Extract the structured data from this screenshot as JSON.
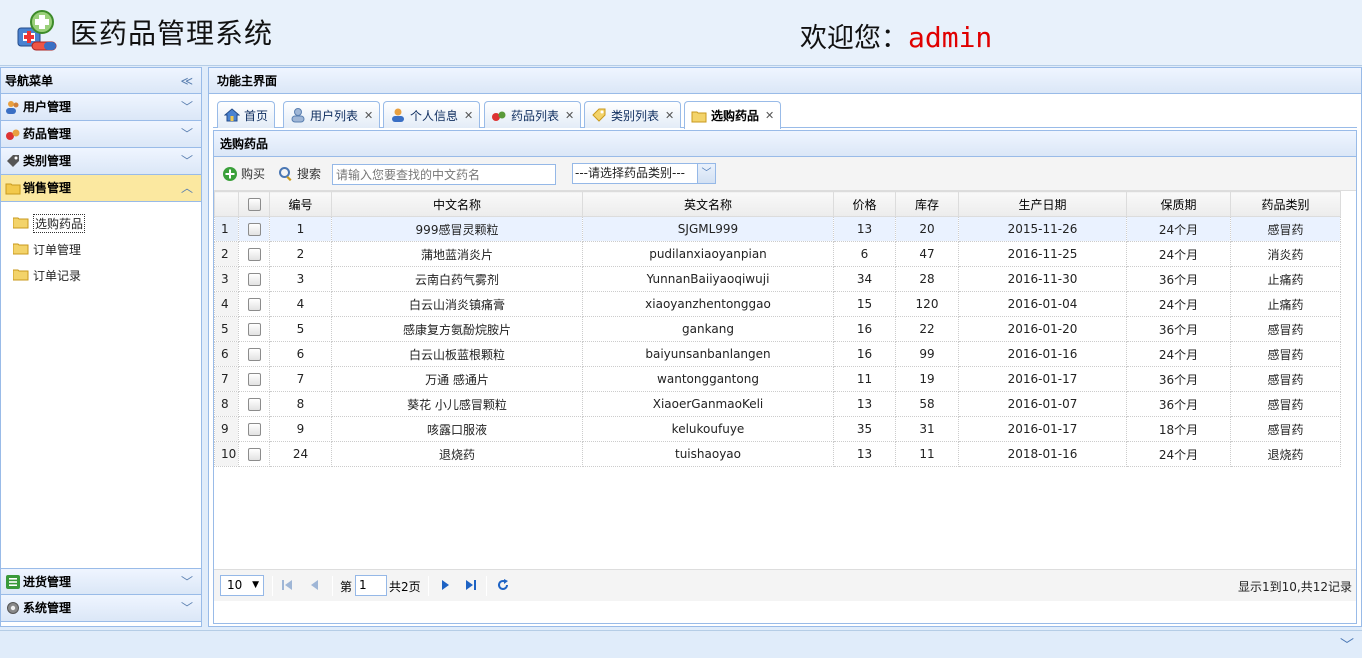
{
  "header": {
    "app_title": "医药品管理系统",
    "welcome_prefix": "欢迎您：",
    "username": "admin"
  },
  "nav": {
    "title": "导航菜单",
    "sections": [
      {
        "label": "用户管理",
        "icon": "users-icon"
      },
      {
        "label": "药品管理",
        "icon": "pills-icon"
      },
      {
        "label": "类别管理",
        "icon": "tag-icon"
      },
      {
        "label": "销售管理",
        "icon": "folder-icon",
        "expanded": true
      }
    ],
    "sub_items": [
      {
        "label": "选购药品",
        "selected": true
      },
      {
        "label": "订单管理"
      },
      {
        "label": "订单记录"
      }
    ],
    "bottom_sections": [
      {
        "label": "进货管理",
        "icon": "list-icon"
      },
      {
        "label": "系统管理",
        "icon": "gear-icon"
      }
    ]
  },
  "main": {
    "title": "功能主界面",
    "tabs": [
      {
        "label": "首页",
        "icon": "home-icon",
        "closable": false
      },
      {
        "label": "用户列表",
        "icon": "user-icon",
        "closable": true
      },
      {
        "label": "个人信息",
        "icon": "person-icon",
        "closable": true
      },
      {
        "label": "药品列表",
        "icon": "pills-icon",
        "closable": true
      },
      {
        "label": "类别列表",
        "icon": "tag-icon",
        "closable": true
      },
      {
        "label": "选购药品",
        "icon": "folder-icon",
        "closable": true,
        "active": true
      }
    ],
    "grid_title": "选购药品",
    "toolbar": {
      "buy_label": "购买",
      "search_label": "搜索",
      "search_placeholder": "请输入您要查找的中文药名",
      "category_select": "---请选择药品类别---"
    },
    "columns": [
      "编号",
      "中文名称",
      "英文名称",
      "价格",
      "库存",
      "生产日期",
      "保质期",
      "药品类别"
    ],
    "rows": [
      {
        "rn": "1",
        "id": "1",
        "cn": "999感冒灵颗粒",
        "en": "SJGML999",
        "price": "13",
        "stock": "20",
        "date": "2015-11-26",
        "shelf": "24个月",
        "cat": "感冒药"
      },
      {
        "rn": "2",
        "id": "2",
        "cn": "蒲地蓝消炎片",
        "en": "pudilanxiaoyanpian",
        "price": "6",
        "stock": "47",
        "date": "2016-11-25",
        "shelf": "24个月",
        "cat": "消炎药"
      },
      {
        "rn": "3",
        "id": "3",
        "cn": "云南白药气雾剂",
        "en": "YunnanBaiiyaoqiwuji",
        "price": "34",
        "stock": "28",
        "date": "2016-11-30",
        "shelf": "36个月",
        "cat": "止痛药"
      },
      {
        "rn": "4",
        "id": "4",
        "cn": "白云山消炎镇痛膏",
        "en": "xiaoyanzhentonggao",
        "price": "15",
        "stock": "120",
        "date": "2016-01-04",
        "shelf": "24个月",
        "cat": "止痛药"
      },
      {
        "rn": "5",
        "id": "5",
        "cn": "感康复方氨酚烷胺片",
        "en": "gankang",
        "price": "16",
        "stock": "22",
        "date": "2016-01-20",
        "shelf": "36个月",
        "cat": "感冒药"
      },
      {
        "rn": "6",
        "id": "6",
        "cn": "白云山板蓝根颗粒",
        "en": "baiyunsanbanlangen",
        "price": "16",
        "stock": "99",
        "date": "2016-01-16",
        "shelf": "24个月",
        "cat": "感冒药"
      },
      {
        "rn": "7",
        "id": "7",
        "cn": "万通 感通片",
        "en": "wantonggantong",
        "price": "11",
        "stock": "19",
        "date": "2016-01-17",
        "shelf": "36个月",
        "cat": "感冒药"
      },
      {
        "rn": "8",
        "id": "8",
        "cn": "葵花 小儿感冒颗粒",
        "en": "XiaoerGanmaoKeli",
        "price": "13",
        "stock": "58",
        "date": "2016-01-07",
        "shelf": "36个月",
        "cat": "感冒药"
      },
      {
        "rn": "9",
        "id": "9",
        "cn": "咳露口服液",
        "en": "kelukoufuye",
        "price": "35",
        "stock": "31",
        "date": "2016-01-17",
        "shelf": "18个月",
        "cat": "感冒药"
      },
      {
        "rn": "10",
        "id": "24",
        "cn": "退烧药",
        "en": "tuishaoyao",
        "price": "13",
        "stock": "11",
        "date": "2018-01-16",
        "shelf": "24个月",
        "cat": "退烧药"
      }
    ],
    "pager": {
      "page_size": "10",
      "page_prefix": "第",
      "current_page": "1",
      "total_pages": "共2页",
      "info": "显示1到10,共12记录"
    }
  },
  "colors": {
    "accent": "#99bbe8",
    "active_accordion": "#fbe8a0",
    "username": "#e00000"
  }
}
